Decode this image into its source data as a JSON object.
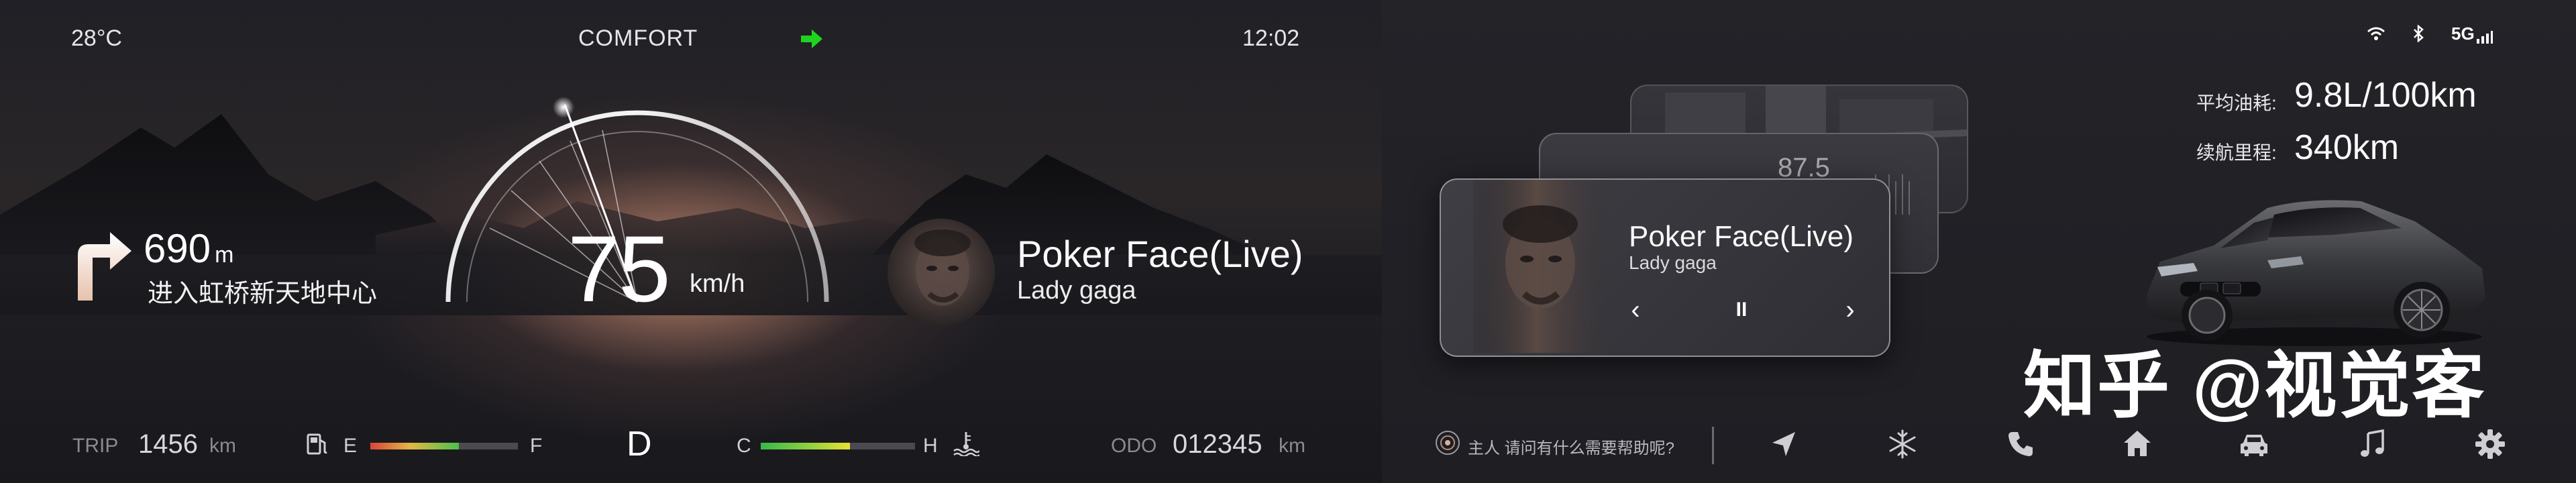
{
  "top_bar": {
    "temperature": "28°C",
    "drive_mode": "COMFORT",
    "clock": "12:02",
    "signal": "5G",
    "turn_signal_color": "#1fd41f"
  },
  "navigation": {
    "distance": "690",
    "distance_unit": "m",
    "road": "进入虹桥新天地中心",
    "icon": "turn-right-arrow-icon"
  },
  "speedometer": {
    "speed": "75",
    "unit": "km/h"
  },
  "media_center": {
    "title": "Poker Face(Live)",
    "artist": "Lady gaga"
  },
  "media_card": {
    "title": "Poker Face(Live)",
    "artist": "Lady gaga",
    "prev_label": "‹",
    "pause_label": "II",
    "next_label": "›",
    "radio_frequency": "87.5"
  },
  "trip_info": {
    "avg_fuel_label": "平均油耗:",
    "avg_fuel_value": "9.8L/100km",
    "range_label": "续航里程:",
    "range_value": "340km"
  },
  "cluster_bottom": {
    "trip_label": "TRIP",
    "trip_value": "1456",
    "trip_unit": "km",
    "fuel_empty": "E",
    "fuel_full": "F",
    "fuel_level": 0.6,
    "gear": "D",
    "coolant_cold": "C",
    "coolant_hot": "H",
    "coolant_level": 0.58,
    "odo_label": "ODO",
    "odo_value": "012345",
    "odo_unit": "km"
  },
  "dock": {
    "voice_prompt": "主人 请问有什么需要帮助呢?",
    "items": [
      "navigation-icon",
      "climate-icon",
      "phone-icon",
      "home-icon",
      "car-icon",
      "music-icon",
      "settings-icon"
    ]
  },
  "watermark": "知乎 @视觉客"
}
